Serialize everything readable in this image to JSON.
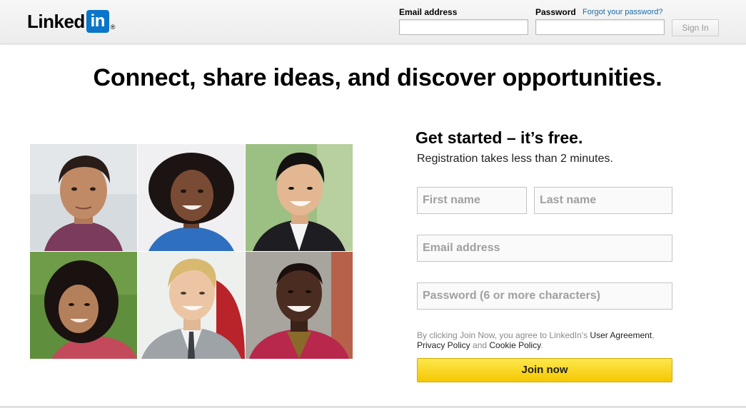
{
  "header": {
    "logo_text": "Linked",
    "logo_box_text": "in",
    "logo_reg": "®",
    "email_label": "Email address",
    "password_label": "Password",
    "forgot_link": "Forgot your password?",
    "signin_label": "Sign In"
  },
  "headline": "Connect, share ideas, and discover opportunities.",
  "signup": {
    "title": "Get started – it’s free.",
    "subtitle": "Registration takes less than 2 minutes.",
    "first_name_placeholder": "First name",
    "last_name_placeholder": "Last name",
    "email_placeholder": "Email address",
    "password_placeholder": "Password (6 or more characters)",
    "terms_prefix": "By clicking Join Now, you agree to LinkedIn's ",
    "user_agreement": "User Agreement",
    "comma": ",",
    "privacy_policy": "Privacy Policy",
    "and": " and ",
    "cookie_policy": "Cookie Policy",
    "period": ".",
    "join_label": "Join now"
  },
  "colors": {
    "brand": "#0b75c9",
    "join_button": "#f5c802",
    "link": "#1b6aa5"
  }
}
